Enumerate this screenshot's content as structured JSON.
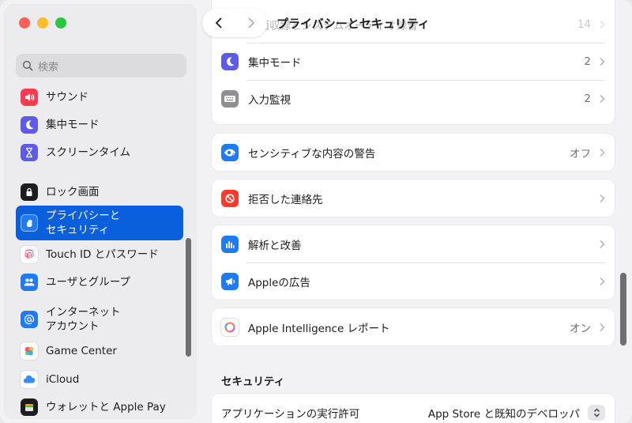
{
  "window": {
    "title": "プライバシーとセキュリティ"
  },
  "sidebar": {
    "search_placeholder": "検索",
    "items": [
      {
        "label": "サウンド",
        "icon": "speaker-icon",
        "color": "#ff3b4f"
      },
      {
        "label": "集中モード",
        "icon": "moon-icon",
        "color": "#5e5ce6"
      },
      {
        "label": "スクリーンタイム",
        "icon": "hourglass-icon",
        "color": "#5e5ce6"
      },
      {
        "label": "ロック画面",
        "icon": "lock-screen-icon",
        "color": "#1d1d1f"
      },
      {
        "label": "プライバシーと",
        "label2": "セキュリティ",
        "icon": "hand-icon",
        "color": "#1e7bf2",
        "selected": true
      },
      {
        "label": "Touch ID とパスワード",
        "icon": "fingerprint-icon",
        "color": "#ffffff"
      },
      {
        "label": "ユーザとグループ",
        "icon": "users-icon",
        "color": "#1e7bf2"
      },
      {
        "label": "インターネット",
        "label2": "アカウント",
        "icon": "at-icon",
        "color": "#1e7bf2"
      },
      {
        "label": "Game Center",
        "icon": "game-center-icon",
        "color": "#ffffff"
      },
      {
        "label": "iCloud",
        "icon": "cloud-icon",
        "color": "#ffffff"
      },
      {
        "label": "ウォレットと Apple Pay",
        "icon": "wallet-icon",
        "color": "#1d1d1f"
      }
    ]
  },
  "main": {
    "partial_row": {
      "label": "画面収録とシステムオーディオ録音",
      "value": "14"
    },
    "group1": [
      {
        "label": "集中モード",
        "value": "2",
        "icon": "moon-icon",
        "color": "#5e5ce6"
      },
      {
        "label": "入力監視",
        "value": "2",
        "icon": "keyboard-icon",
        "color": "#8e8e93"
      }
    ],
    "group2": [
      {
        "label": "センシティブな内容の警告",
        "value": "オフ",
        "icon": "eye-warning-icon",
        "color": "#1e7bf2"
      }
    ],
    "group3": [
      {
        "label": "拒否した連絡先",
        "value": "",
        "icon": "blocked-icon",
        "color": "#ff3b30"
      }
    ],
    "group4": [
      {
        "label": "解析と改善",
        "value": "",
        "icon": "analytics-icon",
        "color": "#1e7bf2"
      },
      {
        "label": "Appleの広告",
        "value": "",
        "icon": "megaphone-icon",
        "color": "#1e7bf2"
      }
    ],
    "group5": [
      {
        "label": "Apple Intelligence レポート",
        "value": "オン",
        "icon": "apple-intelligence-icon",
        "color": "#ffffff"
      }
    ],
    "security_section": {
      "title": "セキュリティ",
      "app_permission_label": "アプリケーションの実行許可",
      "app_permission_value": "App Store と既知のデベロッパ"
    }
  }
}
